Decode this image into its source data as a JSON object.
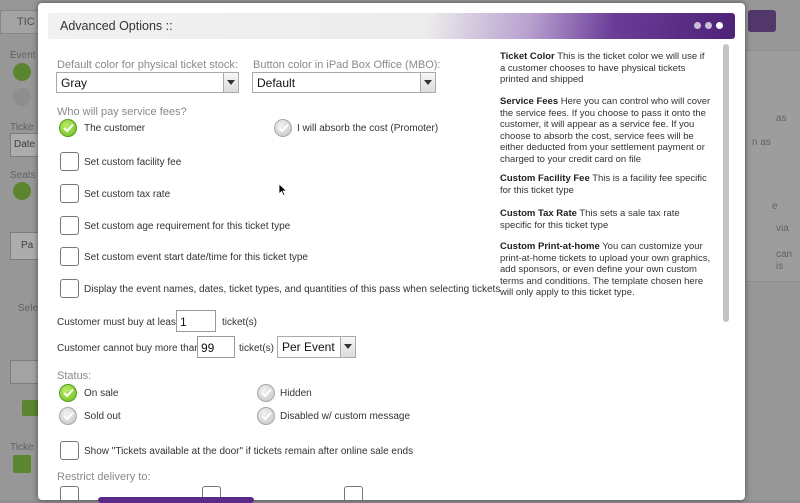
{
  "background": {
    "tab_title": "TIC",
    "labels": [
      "Event",
      "Ticke",
      "Date",
      "Seats",
      "Pa",
      "Sele",
      "Ticke"
    ],
    "right_fragments": [
      "as",
      "n as",
      "e",
      "via",
      "can",
      "is"
    ]
  },
  "modal": {
    "title": "Advanced Options ::",
    "stock_color": {
      "label": "Default color for physical ticket stock:",
      "value": "Gray"
    },
    "button_color": {
      "label": "Button color in iPad Box Office (MBO):",
      "value": "Default"
    },
    "service_fees": {
      "label": "Who will pay service fees?",
      "customer": "The customer",
      "absorb": "I will absorb the cost (Promoter)"
    },
    "checkboxes": [
      "Set custom facility fee",
      "Set custom tax rate",
      "Set custom age requirement for this ticket type",
      "Set custom event start date/time for this ticket type",
      "Display the event names, dates, ticket types, and quantities of this pass when selecting tickets"
    ],
    "min_buy": {
      "label": "Customer must buy at least",
      "value": "1",
      "suffix": "ticket(s)"
    },
    "max_buy": {
      "label": "Customer cannot buy more than",
      "value": "99",
      "suffix": "ticket(s)",
      "per": "Per Event"
    },
    "status": {
      "label": "Status:",
      "on_sale": "On sale",
      "hidden": "Hidden",
      "sold_out": "Sold out",
      "disabled": "Disabled w/ custom message"
    },
    "door_checkbox": "Show \"Tickets available at the door\" if tickets remain after online sale ends",
    "restrict_label": "Restrict delivery to:",
    "help": [
      {
        "title": "Ticket Color",
        "text": "This is the ticket color we will use if a customer chooses to have physical tickets printed and shipped"
      },
      {
        "title": "Service Fees",
        "text": "Here you can control who will cover the service fees. If you choose to pass it onto the customer, it will appear as a service fee. If you choose to absorb the cost, service fees will be either deducted from your settlement payment or charged to your credit card on file"
      },
      {
        "title": "Custom Facility Fee",
        "text": "This is a facility fee specific for this ticket type"
      },
      {
        "title": "Custom Tax Rate",
        "text": "This sets a sale tax rate specific for this ticket type"
      },
      {
        "title": "Custom Print-at-home",
        "text": "You can customize your print-at-home tickets to upload your own graphics, add sponsors, or even define your own custom terms and conditions. The template chosen here will only apply to this ticket type."
      }
    ]
  }
}
